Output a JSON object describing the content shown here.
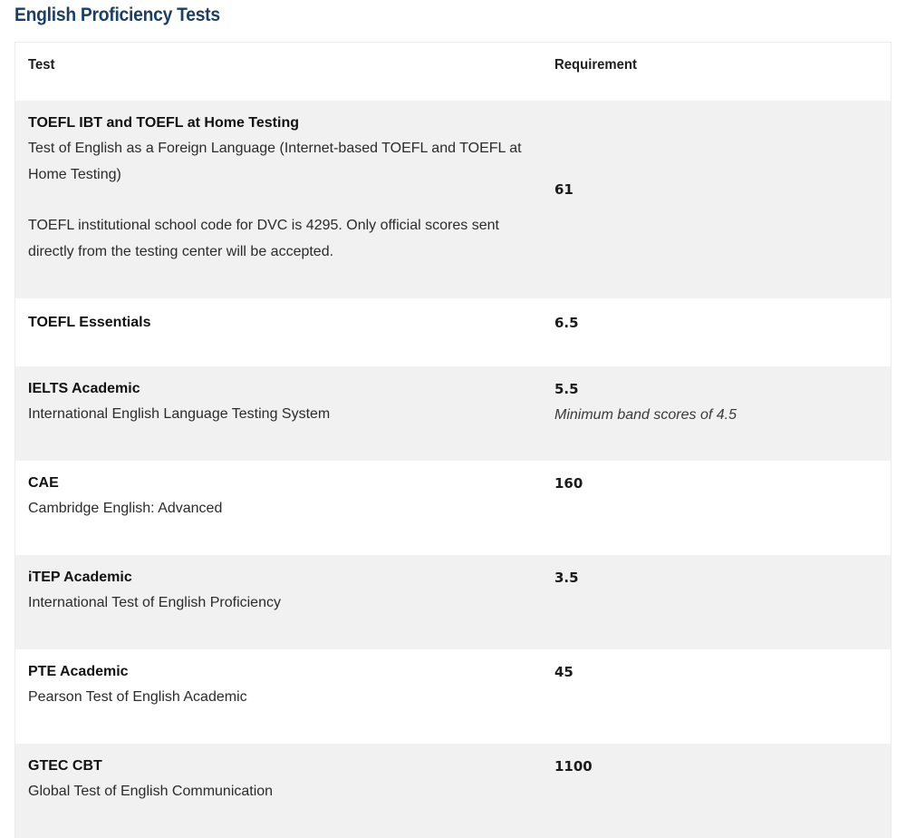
{
  "page": {
    "title": "English Proficiency Tests",
    "title_color": "#1d3f66",
    "shaded_row_color": "#f1f1f1"
  },
  "table": {
    "headers": {
      "test": "Test",
      "requirement": "Requirement"
    },
    "rows": [
      {
        "name": "TOEFL IBT and TOEFL at Home Testing",
        "description": "Test of English as a Foreign Language (Internet-based TOEFL and TOEFL at Home Testing)",
        "note": "TOEFL institutional school code for DVC is 4295. Only official scores sent directly from the testing center will be accepted.",
        "requirement": "61",
        "requirement_note": ""
      },
      {
        "name": "TOEFL Essentials",
        "description": "",
        "note": "",
        "requirement": "6.5",
        "requirement_note": ""
      },
      {
        "name": "IELTS Academic",
        "description": "International English Language Testing System",
        "note": "",
        "requirement": "5.5",
        "requirement_note": "Minimum band scores of 4.5"
      },
      {
        "name": "CAE",
        "description": "Cambridge English: Advanced",
        "note": "",
        "requirement": "160",
        "requirement_note": ""
      },
      {
        "name": "iTEP Academic",
        "description": "International Test of English Proficiency",
        "note": "",
        "requirement": "3.5",
        "requirement_note": ""
      },
      {
        "name": "PTE Academic",
        "description": "Pearson Test of English Academic",
        "note": "",
        "requirement": "45",
        "requirement_note": ""
      },
      {
        "name": "GTEC CBT",
        "description": "Global Test of English Communication",
        "note": "",
        "requirement": "1100",
        "requirement_note": ""
      }
    ]
  }
}
